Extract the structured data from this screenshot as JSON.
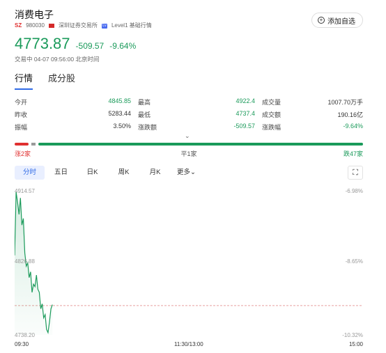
{
  "header": {
    "title": "消费电子",
    "market": "SZ",
    "code": "980030",
    "exchange": "深圳证券交易所",
    "level_icon": "Lv",
    "level": "Level1 基础行情",
    "add_button": "添加自选"
  },
  "quote": {
    "price": "4773.87",
    "change": "-509.57",
    "change_pct": "-9.64%",
    "trade_time": "交易中 04-07 09:56:00 北京时间"
  },
  "tabs": [
    {
      "label": "行情",
      "active": true
    },
    {
      "label": "成分股",
      "active": false
    }
  ],
  "stats": [
    [
      {
        "label": "今开",
        "value": "4845.85",
        "color": "green"
      },
      {
        "label": "最高",
        "value": "4922.4",
        "color": "green"
      },
      {
        "label": "成交量",
        "value": "1007.70万手",
        "color": "normal"
      }
    ],
    [
      {
        "label": "昨收",
        "value": "5283.44",
        "color": "normal"
      },
      {
        "label": "最低",
        "value": "4737.4",
        "color": "green"
      },
      {
        "label": "成交额",
        "value": "190.16亿",
        "color": "normal"
      }
    ],
    [
      {
        "label": "振幅",
        "value": "3.50%",
        "color": "normal"
      },
      {
        "label": "涨跌额",
        "value": "-509.57",
        "color": "green"
      },
      {
        "label": "涨跌幅",
        "value": "-9.64%",
        "color": "green"
      }
    ]
  ],
  "breadth": {
    "up_label": "涨2家",
    "flat_label": "平1家",
    "down_label": "跌47家",
    "up": 2,
    "flat": 1,
    "down": 47
  },
  "periods": [
    {
      "label": "分时",
      "active": true
    },
    {
      "label": "五日",
      "active": false
    },
    {
      "label": "日K",
      "active": false
    },
    {
      "label": "周K",
      "active": false
    },
    {
      "label": "月K",
      "active": false
    },
    {
      "label": "更多⌄",
      "active": false
    }
  ],
  "chart_data": {
    "type": "line",
    "y_left_ticks": [
      "4914.57",
      "4826.88",
      "4738.20"
    ],
    "y_right_ticks": [
      "-6.98%",
      "-8.65%",
      "-10.32%"
    ],
    "x_ticks": [
      "09:30",
      "11:30/13:00",
      "15:00"
    ],
    "ylim": [
      4738.2,
      4914.57
    ],
    "prev_close_ref": 4773.87,
    "minutes_total": 240,
    "x_minutes": [
      0,
      1,
      2,
      3,
      4,
      5,
      6,
      7,
      8,
      9,
      10,
      11,
      12,
      13,
      14,
      15,
      16,
      17,
      18,
      19,
      20,
      21,
      22,
      23,
      24,
      25,
      26
    ],
    "values": [
      4835,
      4912,
      4900,
      4885,
      4905,
      4872,
      4880,
      4838,
      4822,
      4826,
      4808,
      4815,
      4790,
      4800,
      4797,
      4811,
      4794,
      4790,
      4770,
      4776,
      4759,
      4763,
      4745,
      4741,
      4754,
      4770,
      4775
    ]
  },
  "colors": {
    "green": "#1a9a5a",
    "red": "#e03030",
    "accent": "#2f6ae6"
  }
}
